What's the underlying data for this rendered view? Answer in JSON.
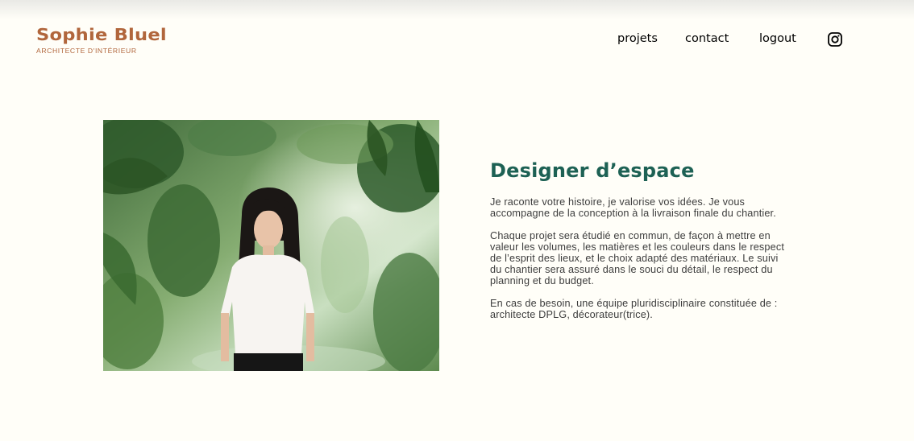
{
  "header": {
    "logo_title": "Sophie Bluel",
    "logo_subtitle": "ARCHITECTE D'INTÉRIEUR",
    "nav": [
      {
        "label": "projets"
      },
      {
        "label": "contact"
      },
      {
        "label": "logout"
      }
    ],
    "instagram_icon": "instagram-icon"
  },
  "introduction": {
    "photo_icon": "portrait-photo",
    "title": "Designer d’espace",
    "paragraphs": [
      "Je raconte votre histoire, je valorise vos idées. Je vous accompagne de la conception à la livraison finale du chantier.",
      "Chaque projet sera étudié en commun, de façon à mettre en valeur les volumes, les matières et les couleurs dans le respect de l’esprit des lieux, et le choix adapté des matériaux. Le suivi du chantier sera assuré dans le souci du détail, le respect du planning et du budget.",
      "En cas de besoin, une équipe pluridisciplinaire constituée de : architecte DPLG, décorateur(trice)."
    ]
  },
  "colors": {
    "background": "#FFFEF8",
    "brand": "#B1663C",
    "title_green": "#1D6154",
    "text": "#3D3D3D"
  }
}
